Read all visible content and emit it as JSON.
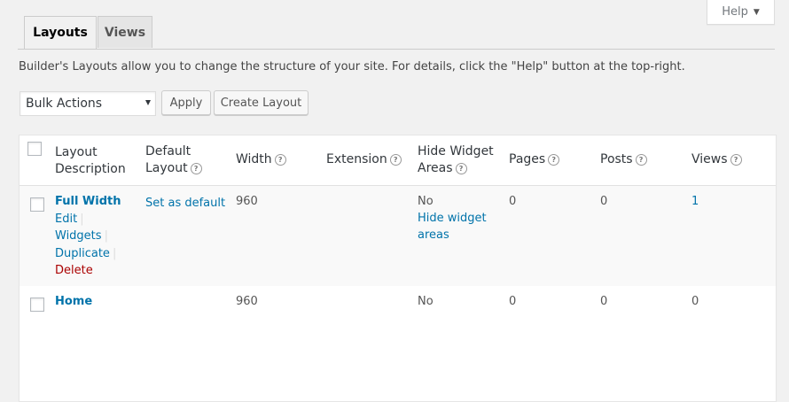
{
  "help": {
    "label": "Help",
    "caret": "▼"
  },
  "tabs": [
    {
      "label": "Layouts",
      "active": true
    },
    {
      "label": "Views",
      "active": false
    }
  ],
  "description": "Builder's Layouts allow you to change the structure of your site. For details, click the \"Help\" button at the top-right.",
  "bulk_actions": {
    "selected": "Bulk Actions",
    "apply_label": "Apply"
  },
  "create_layout_label": "Create Layout",
  "table": {
    "headers": {
      "layout_description_1": "Layout",
      "layout_description_2": "Description",
      "default_layout_1": "Default",
      "default_layout_2": "Layout",
      "width": "Width",
      "extension": "Extension",
      "hide_widget_areas_1": "Hide Widget",
      "hide_widget_areas_2": "Areas",
      "pages": "Pages",
      "posts": "Posts",
      "views": "Views",
      "help_icon": "?"
    },
    "rows": [
      {
        "title": "Full Width",
        "actions": {
          "edit": "Edit",
          "widgets": "Widgets",
          "duplicate": "Duplicate",
          "delete": "Delete",
          "separator": "|"
        },
        "default_action": "Set as default",
        "width": "960",
        "extension": "",
        "hide_widget_areas": "No",
        "hide_widget_link_1": "Hide widget",
        "hide_widget_link_2": "areas",
        "pages": "0",
        "posts": "0",
        "views": "1"
      },
      {
        "title": "Home",
        "width": "960",
        "extension": "",
        "hide_widget_areas": "No",
        "pages": "0",
        "posts": "0",
        "views": "0"
      }
    ]
  },
  "colors": {
    "link": "#0073aa",
    "delete": "#aa0000",
    "background": "#f1f1f1"
  }
}
